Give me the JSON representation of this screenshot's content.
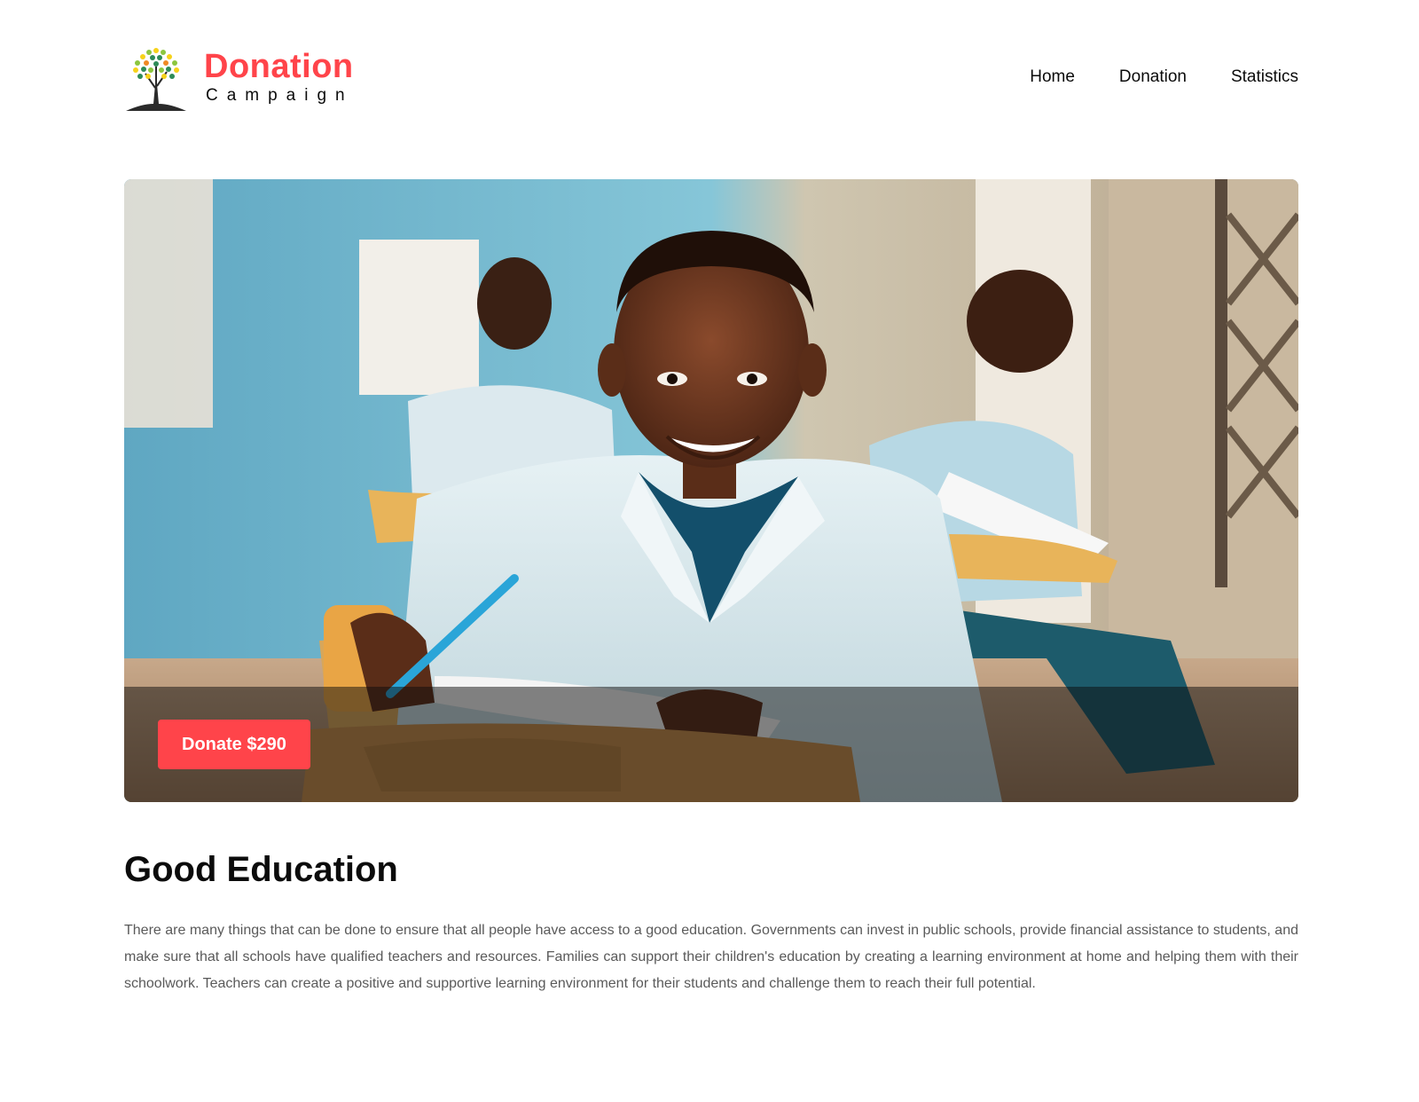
{
  "brand": {
    "title": "Donation",
    "subtitle": "Campaign",
    "logo_icon": "tree-icon",
    "accent_color": "#FF444A"
  },
  "nav": {
    "items": [
      {
        "label": "Home"
      },
      {
        "label": "Donation"
      },
      {
        "label": "Statistics"
      }
    ]
  },
  "hero": {
    "image_icon": "classroom-photo",
    "donate_label": "Donate $290"
  },
  "content": {
    "title": "Good Education",
    "description": "There are many things that can be done to ensure that all people have access to a good education. Governments can invest in public schools, provide financial assistance to students, and make sure that all schools have qualified teachers and resources. Families can support their children's education by creating a learning environment at home and helping them with their schoolwork. Teachers can create a positive and supportive learning environment for their students and challenge them to reach their full potential."
  }
}
